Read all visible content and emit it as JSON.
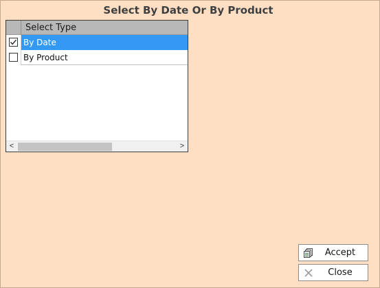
{
  "dialog": {
    "title": "Select By Date Or By Product"
  },
  "grid": {
    "column_header": "Select Type",
    "rows": [
      {
        "label": "By Date",
        "checked": true,
        "selected": true
      },
      {
        "label": "By Product",
        "checked": false,
        "selected": false
      }
    ],
    "scrollbar": {
      "left_arrow": "<",
      "right_arrow": ">"
    }
  },
  "buttons": {
    "accept": {
      "label": "Accept",
      "icon": "copy-icon"
    },
    "close": {
      "label": "Close",
      "icon": "close-icon"
    }
  },
  "colors": {
    "background": "#fedfc4",
    "selection": "#3399f3",
    "header": "#b8b8b8"
  }
}
